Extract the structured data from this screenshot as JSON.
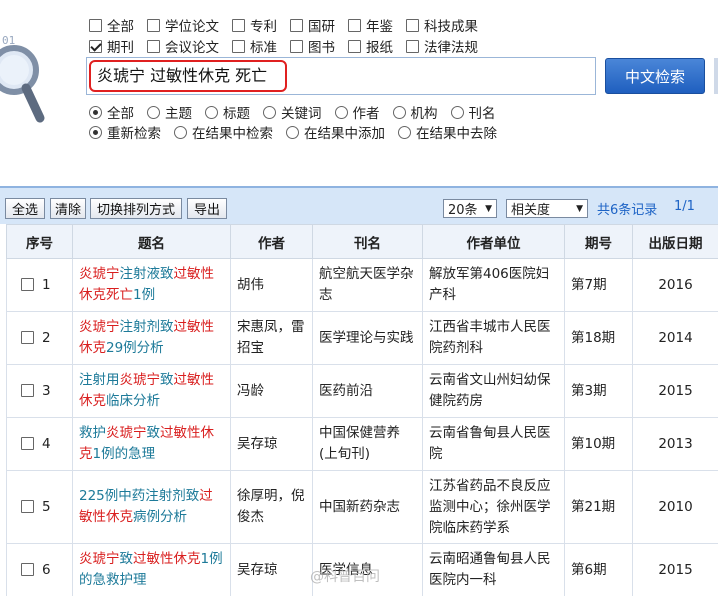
{
  "search": {
    "types_row1": [
      {
        "label": "全部",
        "checked": false
      },
      {
        "label": "学位论文",
        "checked": false
      },
      {
        "label": "专利",
        "checked": false
      },
      {
        "label": "国研",
        "checked": false
      },
      {
        "label": "年鉴",
        "checked": false
      },
      {
        "label": "科技成果",
        "checked": false
      }
    ],
    "types_row2": [
      {
        "label": "期刊",
        "checked": true
      },
      {
        "label": "会议论文",
        "checked": false
      },
      {
        "label": "标准",
        "checked": false
      },
      {
        "label": "图书",
        "checked": false
      },
      {
        "label": "报纸",
        "checked": false
      },
      {
        "label": "法律法规",
        "checked": false
      }
    ],
    "query": "炎琥宁  过敏性休克  死亡",
    "button_label": "中文检索",
    "fields": [
      {
        "label": "全部",
        "checked": true
      },
      {
        "label": "主题",
        "checked": false
      },
      {
        "label": "标题",
        "checked": false
      },
      {
        "label": "关键词",
        "checked": false
      },
      {
        "label": "作者",
        "checked": false
      },
      {
        "label": "机构",
        "checked": false
      },
      {
        "label": "刊名",
        "checked": false
      }
    ],
    "modes": [
      {
        "label": "重新检索",
        "checked": true
      },
      {
        "label": "在结果中检索",
        "checked": false
      },
      {
        "label": "在结果中添加",
        "checked": false
      },
      {
        "label": "在结果中去除",
        "checked": false
      }
    ]
  },
  "toolbar": {
    "select_all": "全选",
    "clear": "清除",
    "switch_sort": "切换排列方式",
    "export": "导出",
    "per_page": "20条",
    "sort_by": "相关度",
    "total": "共6条记录",
    "page": "1/1"
  },
  "table": {
    "headers": [
      "序号",
      "题名",
      "作者",
      "刊名",
      "作者单位",
      "期号",
      "出版日期"
    ],
    "rows": [
      {
        "no": "1",
        "title_parts": [
          [
            "炎琥宁",
            true
          ],
          [
            "注射液致",
            false
          ],
          [
            "过敏性休克死亡",
            true
          ],
          [
            "1例",
            false
          ]
        ],
        "author": "胡伟",
        "journal": "航空航天医学杂志",
        "org": "解放军第406医院妇产科",
        "issue": "第7期",
        "date": "2016"
      },
      {
        "no": "2",
        "title_parts": [
          [
            "炎琥宁",
            true
          ],
          [
            "注射剂致",
            false
          ],
          [
            "过敏性休克",
            true
          ],
          [
            "29例分析",
            false
          ]
        ],
        "author": "宋惠凤，雷招宝",
        "journal": "医学理论与实践",
        "org": "江西省丰城市人民医院药剂科",
        "issue": "第18期",
        "date": "2014"
      },
      {
        "no": "3",
        "title_parts": [
          [
            "注射用",
            false
          ],
          [
            "炎琥宁",
            true
          ],
          [
            "致",
            false
          ],
          [
            "过敏性休克",
            true
          ],
          [
            "临床分析",
            false
          ]
        ],
        "author": "冯龄",
        "journal": "医药前沿",
        "org": "云南省文山州妇幼保健院药房",
        "issue": "第3期",
        "date": "2015"
      },
      {
        "no": "4",
        "title_parts": [
          [
            "救护",
            false
          ],
          [
            "炎琥宁",
            true
          ],
          [
            "致",
            false
          ],
          [
            "过敏性休克",
            true
          ],
          [
            "1例的急理",
            false
          ]
        ],
        "author": "吴存琼",
        "journal": "中国保健营养(上旬刊)",
        "org": "云南省鲁甸县人民医院",
        "issue": "第10期",
        "date": "2013"
      },
      {
        "no": "5",
        "title_parts": [
          [
            "225例中药注射剂致",
            false
          ],
          [
            "过敏性休克",
            true
          ],
          [
            "病例分析",
            false
          ]
        ],
        "author": "徐厚明，倪俊杰",
        "journal": "中国新药杂志",
        "org": "江苏省药品不良反应监测中心；徐州医学院临床药学系",
        "issue": "第21期",
        "date": "2010"
      },
      {
        "no": "6",
        "title_parts": [
          [
            "炎琥宁",
            true
          ],
          [
            "致",
            false
          ],
          [
            "过敏性休克",
            true
          ],
          [
            "1例的急救护理",
            false
          ]
        ],
        "author": "吴存琼",
        "journal": "医学信息",
        "org": "云南昭通鲁甸县人民医院内一科",
        "issue": "第6期",
        "date": "2015"
      }
    ]
  },
  "watermark": "@科普百问"
}
